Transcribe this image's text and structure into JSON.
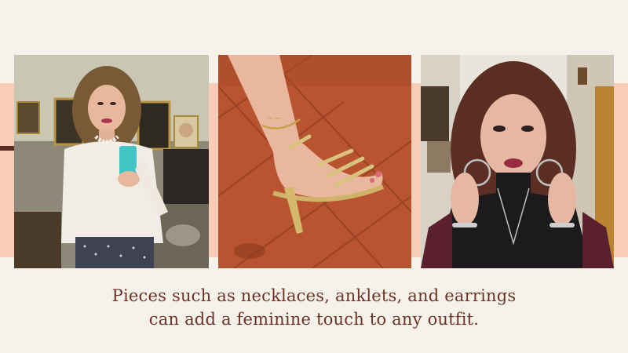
{
  "caption": {
    "line1": "Pieces such as necklaces, anklets, and earrings",
    "line2": "can add a feminine touch to any outfit."
  },
  "photos": [
    {
      "subject": "woman in white blouse with pearl necklace taking mirror selfie"
    },
    {
      "subject": "foot in gold strappy high-heel sandal with name anklet"
    },
    {
      "subject": "woman in black turtleneck touching hoop earrings"
    }
  ],
  "colors": {
    "background": "#f7f2e9",
    "band": "#f8cdb8",
    "caption_text": "#6b3328",
    "accent": "#5a2c22"
  }
}
